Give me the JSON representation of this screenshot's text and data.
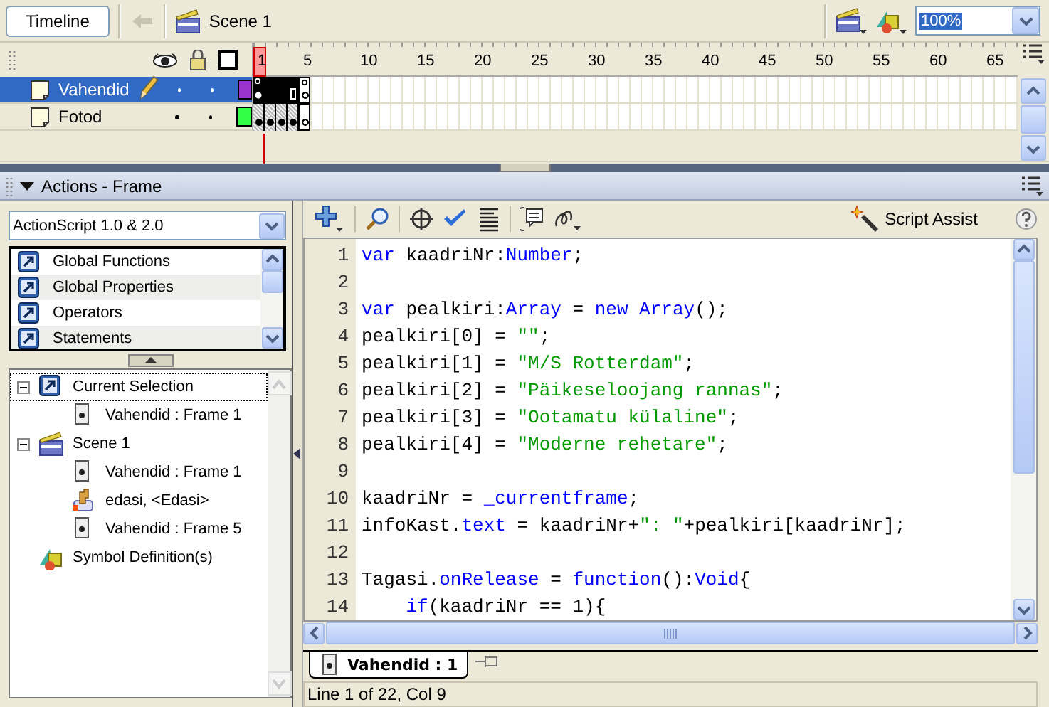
{
  "toolbar": {
    "timeline_button": "Timeline",
    "scene": "Scene 1",
    "zoom": "100%"
  },
  "timeline": {
    "ruler": [
      "1",
      "5",
      "10",
      "15",
      "20",
      "25",
      "30",
      "35",
      "40",
      "45",
      "50",
      "55",
      "60",
      "65"
    ],
    "layers": [
      {
        "name": "Vahendid",
        "selected": true,
        "editing": true,
        "color": "#9933cc",
        "frames": [
          {
            "kind": "key-action"
          },
          {
            "kind": "span"
          },
          {
            "kind": "span"
          },
          {
            "kind": "span-end"
          },
          {
            "kind": "empty-key-action"
          }
        ]
      },
      {
        "name": "Fotod",
        "selected": false,
        "editing": false,
        "color": "#33ff44",
        "frames": [
          {
            "kind": "key"
          },
          {
            "kind": "key"
          },
          {
            "kind": "key"
          },
          {
            "kind": "key"
          },
          {
            "kind": "empty-key"
          }
        ]
      }
    ]
  },
  "actions": {
    "title": "Actions - Frame",
    "version": "ActionScript 1.0 & 2.0",
    "toolbox": [
      "Global Functions",
      "Global Properties",
      "Operators",
      "Statements"
    ],
    "tree": [
      {
        "label": "Current Selection",
        "kind": "selection",
        "selected": true,
        "expanded": true,
        "children": [
          {
            "label": "Vahendid : Frame 1",
            "kind": "frame",
            "selected": false
          }
        ]
      },
      {
        "label": "Scene 1",
        "kind": "scene",
        "selected": false,
        "expanded": true,
        "children": [
          {
            "label": "Vahendid : Frame 1",
            "kind": "frame",
            "selected": false
          },
          {
            "label": "edasi, <Edasi>",
            "kind": "button",
            "selected": false
          },
          {
            "label": "Vahendid : Frame 5",
            "kind": "frame",
            "selected": false
          }
        ]
      },
      {
        "label": "Symbol Definition(s)",
        "kind": "symbols",
        "selected": false
      }
    ],
    "script_assist": "Script Assist",
    "code": [
      {
        "n": "1",
        "tokens": [
          {
            "kind": "keyword",
            "text": "var"
          },
          {
            "kind": "plain",
            "text": " kaadriNr:"
          },
          {
            "kind": "keyword",
            "text": "Number"
          },
          {
            "kind": "plain",
            "text": ";"
          }
        ]
      },
      {
        "n": "2"
      },
      {
        "n": "3",
        "tokens": [
          {
            "kind": "keyword",
            "text": "var"
          },
          {
            "kind": "plain",
            "text": " pealkiri:"
          },
          {
            "kind": "keyword",
            "text": "Array"
          },
          {
            "kind": "plain",
            "text": " = "
          },
          {
            "kind": "keyword",
            "text": "new Array"
          },
          {
            "kind": "plain",
            "text": "();"
          }
        ]
      },
      {
        "n": "4",
        "tokens": [
          {
            "kind": "plain",
            "text": "pealkiri[0] = "
          },
          {
            "kind": "string",
            "text": "\"\""
          },
          {
            "kind": "plain",
            "text": ";"
          }
        ]
      },
      {
        "n": "5",
        "tokens": [
          {
            "kind": "plain",
            "text": "pealkiri[1] = "
          },
          {
            "kind": "string",
            "text": "\"M/S Rotterdam\""
          },
          {
            "kind": "plain",
            "text": ";"
          }
        ]
      },
      {
        "n": "6",
        "tokens": [
          {
            "kind": "plain",
            "text": "pealkiri[2] = "
          },
          {
            "kind": "string",
            "text": "\"Päikeseloojang rannas\""
          },
          {
            "kind": "plain",
            "text": ";"
          }
        ]
      },
      {
        "n": "7",
        "tokens": [
          {
            "kind": "plain",
            "text": "pealkiri[3] = "
          },
          {
            "kind": "string",
            "text": "\"Ootamatu külaline\""
          },
          {
            "kind": "plain",
            "text": ";"
          }
        ]
      },
      {
        "n": "8",
        "tokens": [
          {
            "kind": "plain",
            "text": "pealkiri[4] = "
          },
          {
            "kind": "string",
            "text": "\"Moderne rehetare\""
          },
          {
            "kind": "plain",
            "text": ";"
          }
        ]
      },
      {
        "n": "9"
      },
      {
        "n": "10",
        "tokens": [
          {
            "kind": "plain",
            "text": "kaadriNr = "
          },
          {
            "kind": "keyword",
            "text": "_currentframe"
          },
          {
            "kind": "plain",
            "text": ";"
          }
        ]
      },
      {
        "n": "11",
        "tokens": [
          {
            "kind": "plain",
            "text": "infoKast."
          },
          {
            "kind": "keyword",
            "text": "text"
          },
          {
            "kind": "plain",
            "text": " = kaadriNr+"
          },
          {
            "kind": "string",
            "text": "\": \""
          },
          {
            "kind": "plain",
            "text": "+pealkiri[kaadriNr];"
          }
        ]
      },
      {
        "n": "12"
      },
      {
        "n": "13",
        "tokens": [
          {
            "kind": "plain",
            "text": "Tagasi."
          },
          {
            "kind": "keyword",
            "text": "onRelease"
          },
          {
            "kind": "plain",
            "text": " = "
          },
          {
            "kind": "keyword",
            "text": "function"
          },
          {
            "kind": "plain",
            "text": "():"
          },
          {
            "kind": "keyword",
            "text": "Void"
          },
          {
            "kind": "plain",
            "text": "{"
          }
        ]
      },
      {
        "n": "14",
        "indented": true,
        "tokens": [
          {
            "kind": "keyword",
            "text": "if"
          },
          {
            "kind": "plain",
            "text": "(kaadriNr == 1){"
          }
        ]
      }
    ],
    "tabs": [
      {
        "label": "Vahendid : 1",
        "selected": true
      }
    ],
    "status": "Line 1 of 22, Col 9"
  }
}
